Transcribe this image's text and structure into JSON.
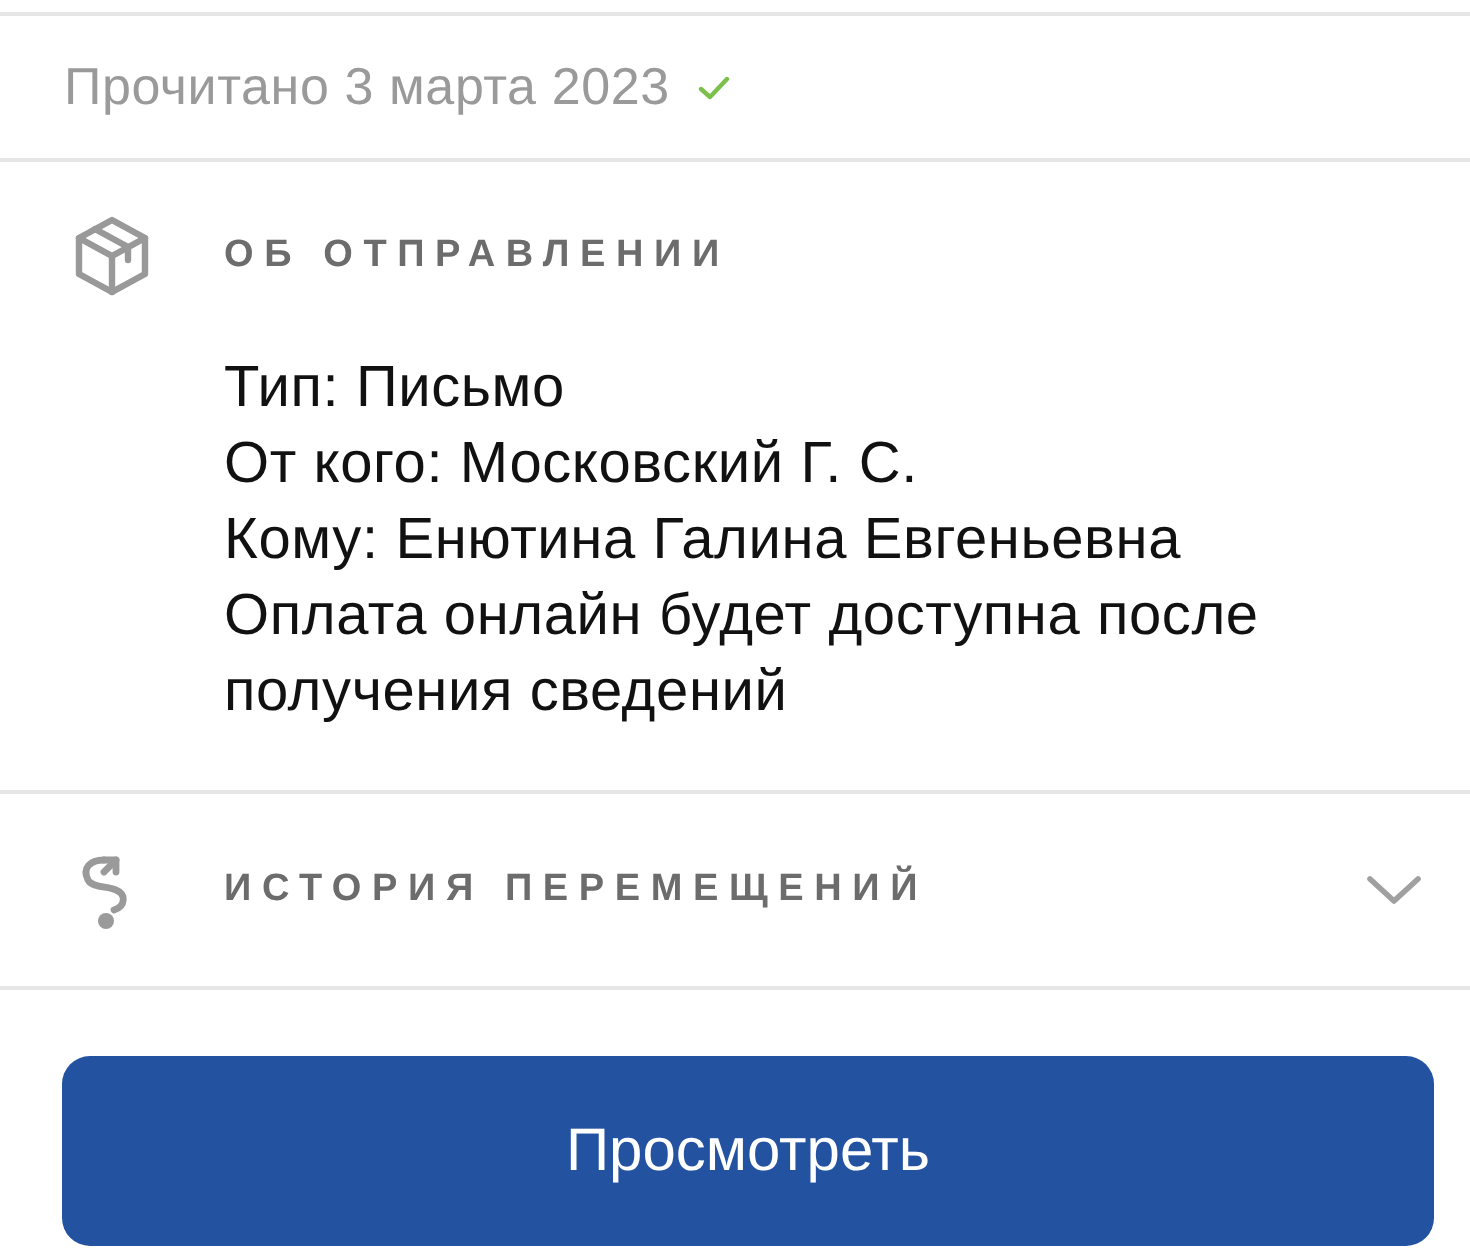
{
  "read_status": {
    "text": "Прочитано 3 марта 2023",
    "read": true
  },
  "sections": [
    {
      "kind": "details",
      "title": "ОБ ОТПРАВЛЕНИИ",
      "lines": [
        "Тип: Письмо",
        "От кого: Московский Г. С.",
        "Кому: Енютина Галина Евгеньевна",
        "Оплата онлайн будет доступна после получения сведений"
      ]
    },
    {
      "kind": "history",
      "title": "ИСТОРИЯ ПЕРЕМЕЩЕНИЙ",
      "expanded": false
    }
  ],
  "button": {
    "label": "Просмотреть"
  }
}
